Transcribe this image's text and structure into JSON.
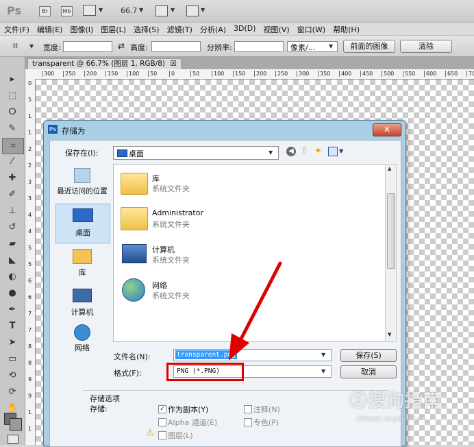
{
  "appbar": {
    "logo": "Ps",
    "br": "Br",
    "mb": "Mb",
    "zoom": "66.7"
  },
  "menu": [
    "文件(F)",
    "编辑(E)",
    "图像(I)",
    "图层(L)",
    "选择(S)",
    "滤镜(T)",
    "分析(A)",
    "3D(D)",
    "视图(V)",
    "窗口(W)",
    "帮助(H)"
  ],
  "options": {
    "width_label": "宽度:",
    "height_label": "高度:",
    "resolution_label": "分辨率:",
    "unit_value": "像素/...",
    "front_image_button": "前面的图像",
    "clear_button": "清除"
  },
  "document": {
    "tab_title": "transparent @ 66.7% (图层 1, RGB/8)",
    "tab_close": "☒",
    "ruler_h": [
      "300",
      "250",
      "200",
      "150",
      "100",
      "50",
      "0",
      "50",
      "100",
      "150",
      "200",
      "250",
      "300",
      "350",
      "400",
      "450",
      "500",
      "550",
      "600",
      "650",
      "700"
    ],
    "ruler_v": [
      "0",
      "5",
      "1",
      "1",
      "2",
      "2",
      "3",
      "3",
      "4",
      "4",
      "5",
      "5",
      "6",
      "6",
      "7",
      "7",
      "8",
      "8",
      "9",
      "9",
      "1",
      "1"
    ]
  },
  "dialog": {
    "title": "存储为",
    "close": "✕",
    "save_in_label": "保存在(I):",
    "save_in_value": "桌面",
    "places": [
      "最近访问的位置",
      "桌面",
      "库",
      "计算机",
      "网络"
    ],
    "files": [
      {
        "name": "库",
        "type": "系统文件夹"
      },
      {
        "name": "Administrator",
        "type": "系统文件夹"
      },
      {
        "name": "计算机",
        "type": "系统文件夹"
      },
      {
        "name": "网络",
        "type": "系统文件夹"
      }
    ],
    "filename_label": "文件名(N):",
    "filename_value": "transparent.png",
    "format_label": "格式(F):",
    "format_value": "PNG (*.PNG)",
    "save_button": "保存(S)",
    "cancel_button": "取消",
    "options_header": "存储选项",
    "save_label": "存储:",
    "as_copy": "作为副本(Y)",
    "notes": "注释(N)",
    "alpha": "Alpha 通道(E)",
    "spot": "专色(P)",
    "layers": "图层(L)"
  },
  "watermark": {
    "text": "搜狗指南",
    "sub": "zhinan.sogou.com"
  },
  "colors": {
    "annotation_red": "#e10000",
    "dialog_frame": "#a8cfe6",
    "selected_place": "#cfe3f7"
  }
}
